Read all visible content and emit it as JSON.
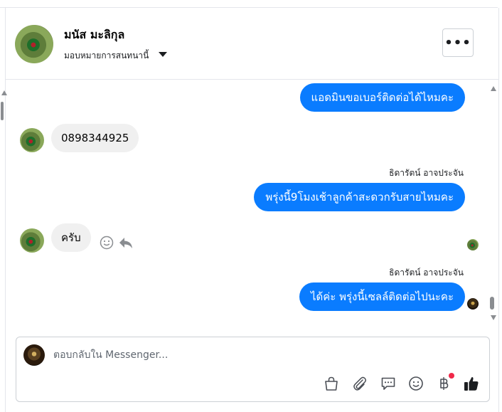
{
  "header": {
    "contact_name": "มนัส มะลิกุล",
    "assign_label": "มอบหมายการสนทนานี้",
    "more_label": "•••"
  },
  "messages": [
    {
      "direction": "out",
      "text": "แอดมินขอเบอร์ติดต่อได้ไหมคะ"
    },
    {
      "direction": "in",
      "text": "0898344925"
    },
    {
      "direction": "out",
      "sender": "ธิดารัตน์ อาจประจัน",
      "text": "พรุ่งนี้9โมงเช้าลูกค้าสะดวกรับสายไหมคะ"
    },
    {
      "direction": "in",
      "text": "ครับ"
    },
    {
      "direction": "out",
      "sender": "ธิดารัตน์ อาจประจัน",
      "text": "ได้ค่ะ พรุ่งนี้เซลล์ติดต่อไปนะคะ"
    }
  ],
  "composer": {
    "placeholder": "ตอบกลับใน Messenger...",
    "tools": [
      "shopping-bag-icon",
      "paperclip-icon",
      "saved-reply-icon",
      "emoji-icon",
      "baht-payment-icon",
      "thumbs-up-icon"
    ]
  },
  "colors": {
    "outgoing_bubble": "#0a7cff",
    "incoming_bubble": "#f0f0f0",
    "notification_dot": "#f02849"
  }
}
